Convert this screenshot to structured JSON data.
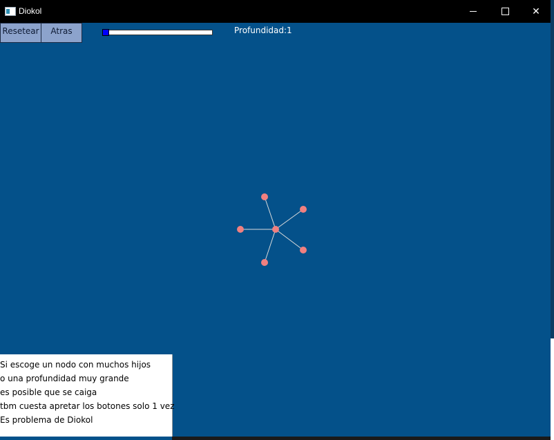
{
  "window": {
    "title": "Diokol",
    "controls": {
      "minimize_icon": "minimize-icon",
      "maximize_icon": "maximize-icon",
      "close_icon": "close-icon",
      "close_glyph": "✕"
    }
  },
  "toolbar": {
    "reset_label": "Resetear",
    "back_label": "Atras",
    "depth_label": "Profundidad:1",
    "depth_value": 1
  },
  "colors": {
    "background": "#04518a",
    "node": "#f08080",
    "edge": "#dcdcdc",
    "button": "#8ca3cc"
  },
  "graph": {
    "center": "center-node",
    "children": [
      "child-node-1",
      "child-node-2",
      "child-node-3",
      "child-node-4",
      "child-node-5"
    ]
  },
  "notice": {
    "lines": [
      "Si escoge un nodo con muchos hijos",
      "o una profundidad muy grande",
      "es posible que se caiga",
      "tbm cuesta apretar los botones solo 1 vez",
      "Es problema de Diokol"
    ]
  }
}
